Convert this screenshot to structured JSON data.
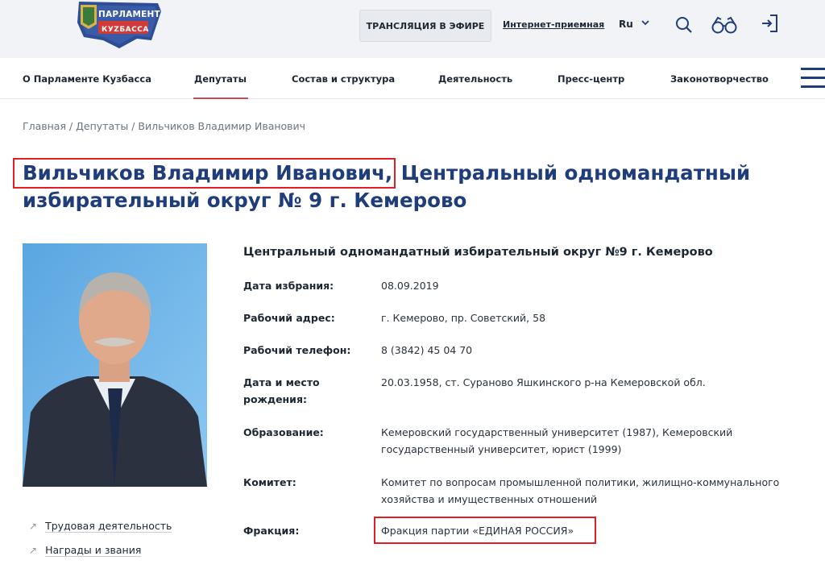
{
  "header": {
    "logo_line1": "ПАРЛАМЕНТ",
    "logo_line2": "КУZБАССА",
    "broadcast_label": "ТРАНСЛЯЦИЯ В ЭФИРЕ",
    "reception_label": "Интернет-приемная",
    "language": "Ru",
    "icons": [
      "search-icon",
      "low-vision-glasses-icon",
      "login-icon",
      "chevron-down-icon",
      "menu-icon"
    ],
    "brand_color": "#1f3d7a",
    "accent_color": "#c94a5e"
  },
  "nav": {
    "items": [
      {
        "label": "О Парламенте Кузбасса",
        "active": false
      },
      {
        "label": "Депутаты",
        "active": true
      },
      {
        "label": "Состав и структура",
        "active": false
      },
      {
        "label": "Деятельность",
        "active": false
      },
      {
        "label": "Пресс-центр",
        "active": false
      },
      {
        "label": "Законотворчество",
        "active": false
      }
    ]
  },
  "breadcrumb": "Главная / Депутаты / Вильчиков Владимир Иванович",
  "title": {
    "name": "Вильчиков Владимир Иванович,",
    "district": " Центральный одномандатный избирательный округ № 9 г. Кемерово"
  },
  "side_links": [
    {
      "label": "Трудовая деятельность"
    },
    {
      "label": "Награды и звания"
    }
  ],
  "info": {
    "heading": "Центральный одномандатный избирательный округ №9 г. Кемерово",
    "rows": [
      {
        "label": "Дата избрания:",
        "value": "08.09.2019"
      },
      {
        "label": "Рабочий адрес:",
        "value": "г. Кемерово, пр. Советский, 58"
      },
      {
        "label": "Рабочий телефон:",
        "value": "8 (3842) 45 04 70"
      },
      {
        "label": "Дата и место рождения:",
        "value": "20.03.1958, ст. Сураново Яшкинского р-на Кемеровской обл."
      },
      {
        "label": "Образование:",
        "value": "Кемеровский государственный университет (1987), Кемеровский государственный университет, юрист (1999)"
      },
      {
        "label": "Комитет:",
        "value": "Комитет по вопросам промышленной политики, жилищно-коммунального хозяйства и имущественных отношений"
      },
      {
        "label": "Фракция:",
        "value": "Фракция партии «ЕДИНАЯ РОССИЯ»"
      }
    ]
  }
}
